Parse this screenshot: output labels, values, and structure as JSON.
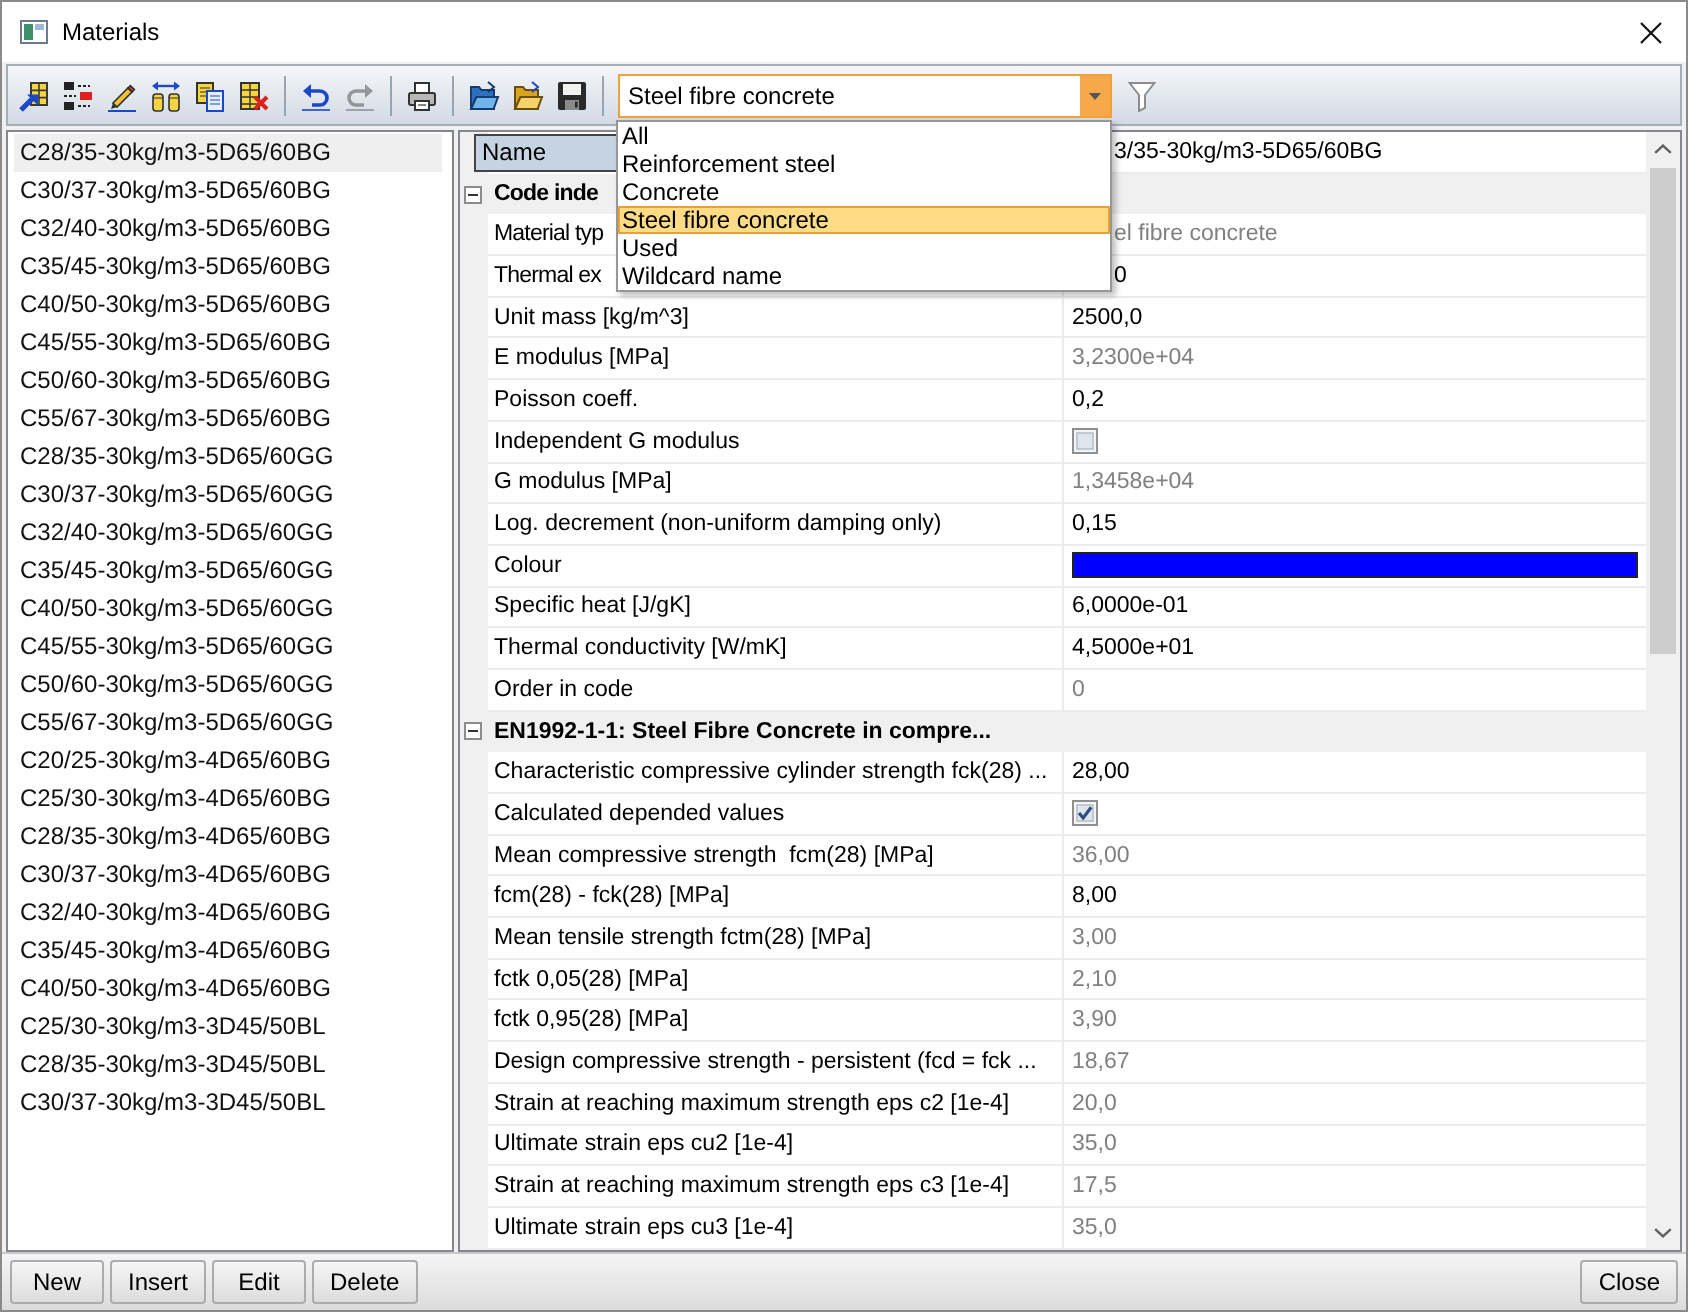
{
  "window": {
    "title": "Materials"
  },
  "toolbar": {
    "groups": [
      {
        "buttons": [
          {
            "disabled": false
          },
          {
            "disabled": false
          },
          {
            "disabled": false
          },
          {
            "disabled": false
          },
          {
            "disabled": false
          },
          {
            "disabled": false
          }
        ]
      },
      {
        "buttons": [
          {
            "disabled": false
          },
          {
            "disabled": true
          }
        ]
      },
      {
        "buttons": [
          {
            "disabled": false
          }
        ]
      },
      {
        "buttons": [
          {
            "disabled": false
          },
          {
            "disabled": false
          },
          {
            "disabled": false
          }
        ]
      }
    ]
  },
  "filter": {
    "value": "Steel fibre concrete",
    "expanded": true,
    "options": [
      {
        "label": "All",
        "selected": false
      },
      {
        "label": "Reinforcement steel",
        "selected": false
      },
      {
        "label": "Concrete",
        "selected": false
      },
      {
        "label": "Steel fibre concrete",
        "selected": true
      },
      {
        "label": "Used",
        "selected": false
      },
      {
        "label": "Wildcard name",
        "selected": false
      }
    ]
  },
  "materials": [
    {
      "name": "C28/35-30kg/m3-5D65/60BG",
      "selected": true
    },
    {
      "name": "C30/37-30kg/m3-5D65/60BG",
      "selected": false
    },
    {
      "name": "C32/40-30kg/m3-5D65/60BG",
      "selected": false
    },
    {
      "name": "C35/45-30kg/m3-5D65/60BG",
      "selected": false
    },
    {
      "name": "C40/50-30kg/m3-5D65/60BG",
      "selected": false
    },
    {
      "name": "C45/55-30kg/m3-5D65/60BG",
      "selected": false
    },
    {
      "name": "C50/60-30kg/m3-5D65/60BG",
      "selected": false
    },
    {
      "name": "C55/67-30kg/m3-5D65/60BG",
      "selected": false
    },
    {
      "name": "C28/35-30kg/m3-5D65/60GG",
      "selected": false
    },
    {
      "name": "C30/37-30kg/m3-5D65/60GG",
      "selected": false
    },
    {
      "name": "C32/40-30kg/m3-5D65/60GG",
      "selected": false
    },
    {
      "name": "C35/45-30kg/m3-5D65/60GG",
      "selected": false
    },
    {
      "name": "C40/50-30kg/m3-5D65/60GG",
      "selected": false
    },
    {
      "name": "C45/55-30kg/m3-5D65/60GG",
      "selected": false
    },
    {
      "name": "C50/60-30kg/m3-5D65/60GG",
      "selected": false
    },
    {
      "name": "C55/67-30kg/m3-5D65/60GG",
      "selected": false
    },
    {
      "name": "C20/25-30kg/m3-4D65/60BG",
      "selected": false
    },
    {
      "name": "C25/30-30kg/m3-4D65/60BG",
      "selected": false
    },
    {
      "name": "C28/35-30kg/m3-4D65/60BG",
      "selected": false
    },
    {
      "name": "C30/37-30kg/m3-4D65/60BG",
      "selected": false
    },
    {
      "name": "C32/40-30kg/m3-4D65/60BG",
      "selected": false
    },
    {
      "name": "C35/45-30kg/m3-4D65/60BG",
      "selected": false
    },
    {
      "name": "C40/50-30kg/m3-4D65/60BG",
      "selected": false
    },
    {
      "name": "C25/30-30kg/m3-3D45/50BL",
      "selected": false
    },
    {
      "name": "C28/35-30kg/m3-3D45/50BL",
      "selected": false
    },
    {
      "name": "C30/37-30kg/m3-3D45/50BL",
      "selected": false
    }
  ],
  "property_grid": {
    "name_row": {
      "label": "Name",
      "value": "3/35-30kg/m3-5D65/60BG"
    },
    "sections": [
      {
        "title": "Code inde",
        "expanded": true,
        "rows": [
          {
            "label": "Material typ",
            "kind": "text",
            "value": "el fibre concrete",
            "readonly": true
          },
          {
            "label": "Thermal ex",
            "kind": "text",
            "value": "0",
            "readonly": false
          },
          {
            "label": "Unit mass [kg/m^3]",
            "kind": "text",
            "value": "2500,0",
            "readonly": false
          },
          {
            "label": "E modulus [MPa]",
            "kind": "text",
            "value": "3,2300e+04",
            "readonly": true
          },
          {
            "label": "Poisson coeff.",
            "kind": "text",
            "value": "0,2",
            "readonly": false
          },
          {
            "label": "Independent G modulus",
            "kind": "checkbox",
            "checked": false
          },
          {
            "label": "G modulus [MPa]",
            "kind": "text",
            "value": "1,3458e+04",
            "readonly": true
          },
          {
            "label": "Log. decrement (non-uniform damping only)",
            "kind": "text",
            "value": "0,15",
            "readonly": false
          },
          {
            "label": "Colour",
            "kind": "color",
            "color": "#0000ff"
          },
          {
            "label": "Specific heat [J/gK]",
            "kind": "text",
            "value": "6,0000e-01",
            "readonly": false
          },
          {
            "label": "Thermal conductivity [W/mK]",
            "kind": "text",
            "value": "4,5000e+01",
            "readonly": false
          },
          {
            "label": "Order in code",
            "kind": "text",
            "value": "0",
            "readonly": true
          }
        ]
      },
      {
        "title": "EN1992-1-1: Steel Fibre Concrete in compre...",
        "expanded": true,
        "rows": [
          {
            "label": "Characteristic compressive cylinder strength fck(28) ...",
            "kind": "text",
            "value": "28,00",
            "readonly": false
          },
          {
            "label": "Calculated depended values",
            "kind": "checkbox",
            "checked": true
          },
          {
            "label": "Mean compressive strength  fcm(28) [MPa]",
            "kind": "text",
            "value": "36,00",
            "readonly": true
          },
          {
            "label": "fcm(28) - fck(28) [MPa]",
            "kind": "text",
            "value": "8,00",
            "readonly": false
          },
          {
            "label": "Mean tensile strength fctm(28) [MPa]",
            "kind": "text",
            "value": "3,00",
            "readonly": true
          },
          {
            "label": "fctk 0,05(28) [MPa]",
            "kind": "text",
            "value": "2,10",
            "readonly": true
          },
          {
            "label": "fctk 0,95(28) [MPa]",
            "kind": "text",
            "value": "3,90",
            "readonly": true
          },
          {
            "label": "Design compressive strength - persistent (fcd = fck ...",
            "kind": "text",
            "value": "18,67",
            "readonly": true
          },
          {
            "label": "Strain at reaching maximum strength eps c2 [1e-4]",
            "kind": "text",
            "value": "20,0",
            "readonly": true
          },
          {
            "label": "Ultimate strain eps cu2 [1e-4]",
            "kind": "text",
            "value": "35,0",
            "readonly": true
          },
          {
            "label": "Strain at reaching maximum strength eps c3 [1e-4]",
            "kind": "text",
            "value": "17,5",
            "readonly": true
          },
          {
            "label": "Ultimate strain eps cu3 [1e-4]",
            "kind": "text",
            "value": "35,0",
            "readonly": true
          }
        ]
      }
    ]
  },
  "buttons": [
    "New",
    "Insert",
    "Edit",
    "Delete"
  ],
  "close_button": "Close"
}
